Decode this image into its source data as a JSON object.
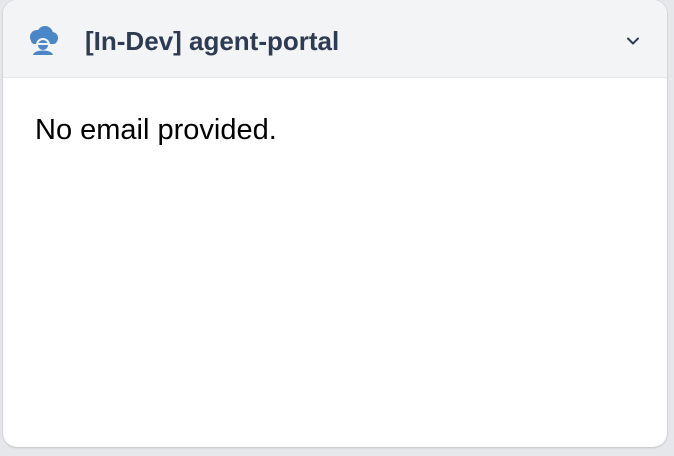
{
  "panel": {
    "title": "[In-Dev] agent-portal",
    "icon": "cloud-user-icon",
    "toggle_icon": "chevron-down-icon",
    "message": "No email provided."
  },
  "colors": {
    "header_background": "#f3f4f6",
    "title_text": "#2d3b53",
    "icon_accent": "#4a86c8",
    "body_background": "#ffffff",
    "body_text": "#000000"
  }
}
